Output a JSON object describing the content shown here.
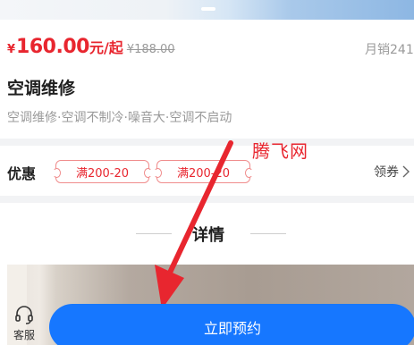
{
  "price": {
    "symbol": "¥",
    "value": "160.00",
    "unit": "元/起",
    "original": "¥188.00"
  },
  "sales_text": "月销241",
  "product": {
    "title": "空调维修",
    "subtitle": "空调维修·空调不制冷·噪音大·空调不启动"
  },
  "coupons": {
    "label": "优惠",
    "items": [
      "满200-20",
      "满200-20"
    ],
    "get_label": "领券"
  },
  "detail": {
    "title": "详情"
  },
  "watermark": "腾飞网",
  "bottom": {
    "service_label": "客服",
    "book_label": "立即预约"
  },
  "colors": {
    "accent": "#1677ff",
    "price": "#e8262f",
    "annotation": "#e8262f"
  }
}
